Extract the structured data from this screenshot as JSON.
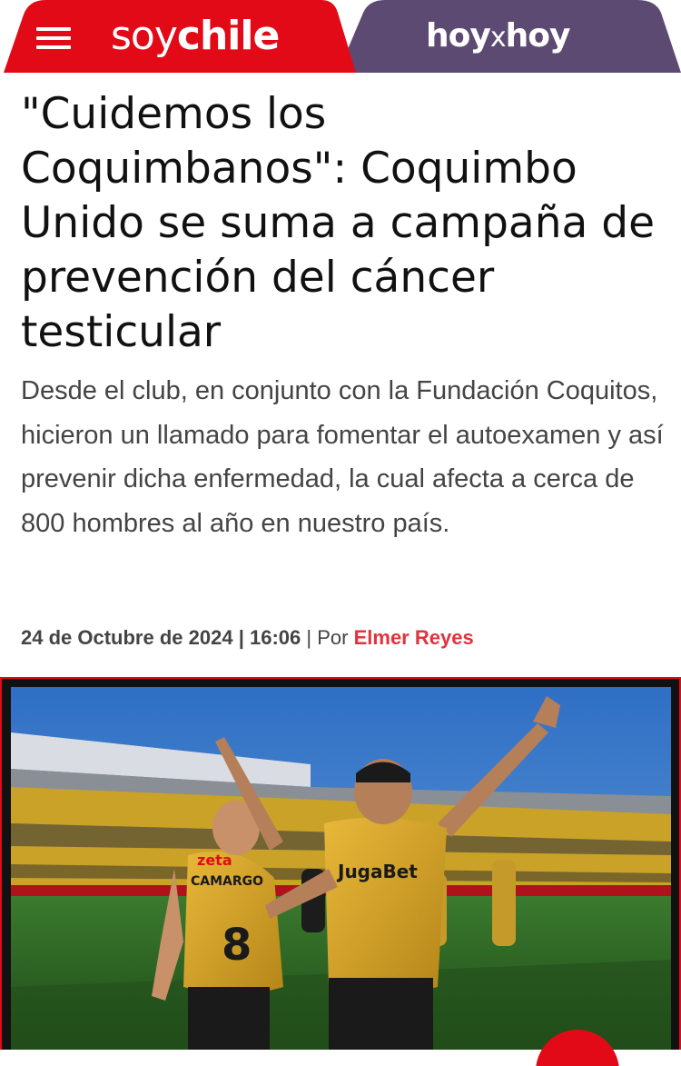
{
  "header": {
    "brand_soy_light": "soy",
    "brand_soy_bold": "chile",
    "brand_hoy_a": "hoy",
    "brand_hoy_x": "x",
    "brand_hoy_b": "hoy",
    "menu_icon": "hamburger-menu-icon",
    "colors": {
      "soy_tab": "#e20a17",
      "hoy_tab": "#5d4a73"
    }
  },
  "article": {
    "title": "\"Cuidemos los Coquimbanos\": Coquimbo Unido se suma a campaña de prevención del cáncer testicular",
    "lead": "Desde el club, en conjunto con la Fundación Coquitos, hicieron un llamado para fomentar el autoexamen y así prevenir dicha enfermedad, la cual afecta a cerca de 800 hombres al año en nuestro país.",
    "date": "24 de Octubre de 2024",
    "separator": "|",
    "time": "16:06",
    "by_label": "Por",
    "author": "Elmer Reyes"
  },
  "photo": {
    "shirt_sponsor": "JugaBet",
    "shirt_sponsor_2": "zeta",
    "player_name": "CAMARGO",
    "player_number": "8"
  }
}
